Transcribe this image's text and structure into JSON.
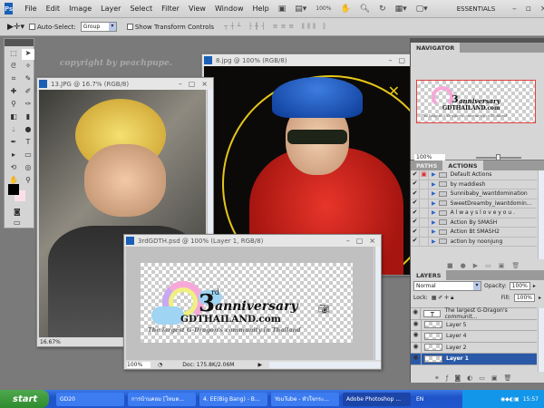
{
  "menubar": {
    "logo": "Ps",
    "items": [
      "File",
      "Edit",
      "Image",
      "Layer",
      "Select",
      "Filter",
      "View",
      "Window",
      "Help"
    ],
    "zoom": "100%",
    "workspace": "ESSENTIALS"
  },
  "options": {
    "auto_select_label": "Auto-Select:",
    "auto_select_value": "Group",
    "show_transform_label": "Show Transform Controls"
  },
  "watermark": "copyright by peachpupe.",
  "windows": {
    "photo8": {
      "title": "8.jpg @ 100% (RGB/8)"
    },
    "photo13": {
      "title": "13.JPG @ 16.7% (RGB/8)",
      "zoom": "16.67%"
    },
    "doc": {
      "title": "3rdGDTH.psd @ 100% (Layer 1, RGB/8)",
      "zoom": "100%",
      "doc_size": "Doc: 175.8K/2.06M"
    }
  },
  "artwork": {
    "number": "3",
    "suffix": "rd",
    "line1": "anniversary",
    "line2": "GDTHAILAND.com",
    "line3": "The largest G-Dragon's community in Thailand"
  },
  "navigator": {
    "tab": "NAVIGATOR",
    "zoom": "100%"
  },
  "actions": {
    "tabs": [
      "PATHS",
      "ACTIONS"
    ],
    "items": [
      "Default Actions",
      "by maddiesh",
      "Sunnibaby_iwantdomination",
      "SweetDreamby_iwantdomin...",
      "A l w a y s l o v e y o u .",
      "Action By SMASH",
      "Action Bt SMASH2",
      "action by noonjung"
    ]
  },
  "layers": {
    "tab": "LAYERS",
    "blend": "Normal",
    "opacity_label": "Opacity:",
    "opacity": "100%",
    "lock_label": "Lock:",
    "fill_label": "Fill:",
    "fill": "100%",
    "items": [
      {
        "name": "The largest G-Dragon's communit...",
        "type": "text"
      },
      {
        "name": "Layer 5"
      },
      {
        "name": "Layer 4"
      },
      {
        "name": "Layer 2"
      },
      {
        "name": "Layer 1",
        "selected": true
      }
    ]
  },
  "taskbar": {
    "start": "start",
    "tasks": [
      "GD20",
      "การบ้านคอม [โหมด...",
      "4. EE(Big Bang) - B...",
      "YouTube - หัวใจกระ...",
      "Adobe Photoshop ..."
    ],
    "lang": "EN",
    "time": "15:57"
  }
}
